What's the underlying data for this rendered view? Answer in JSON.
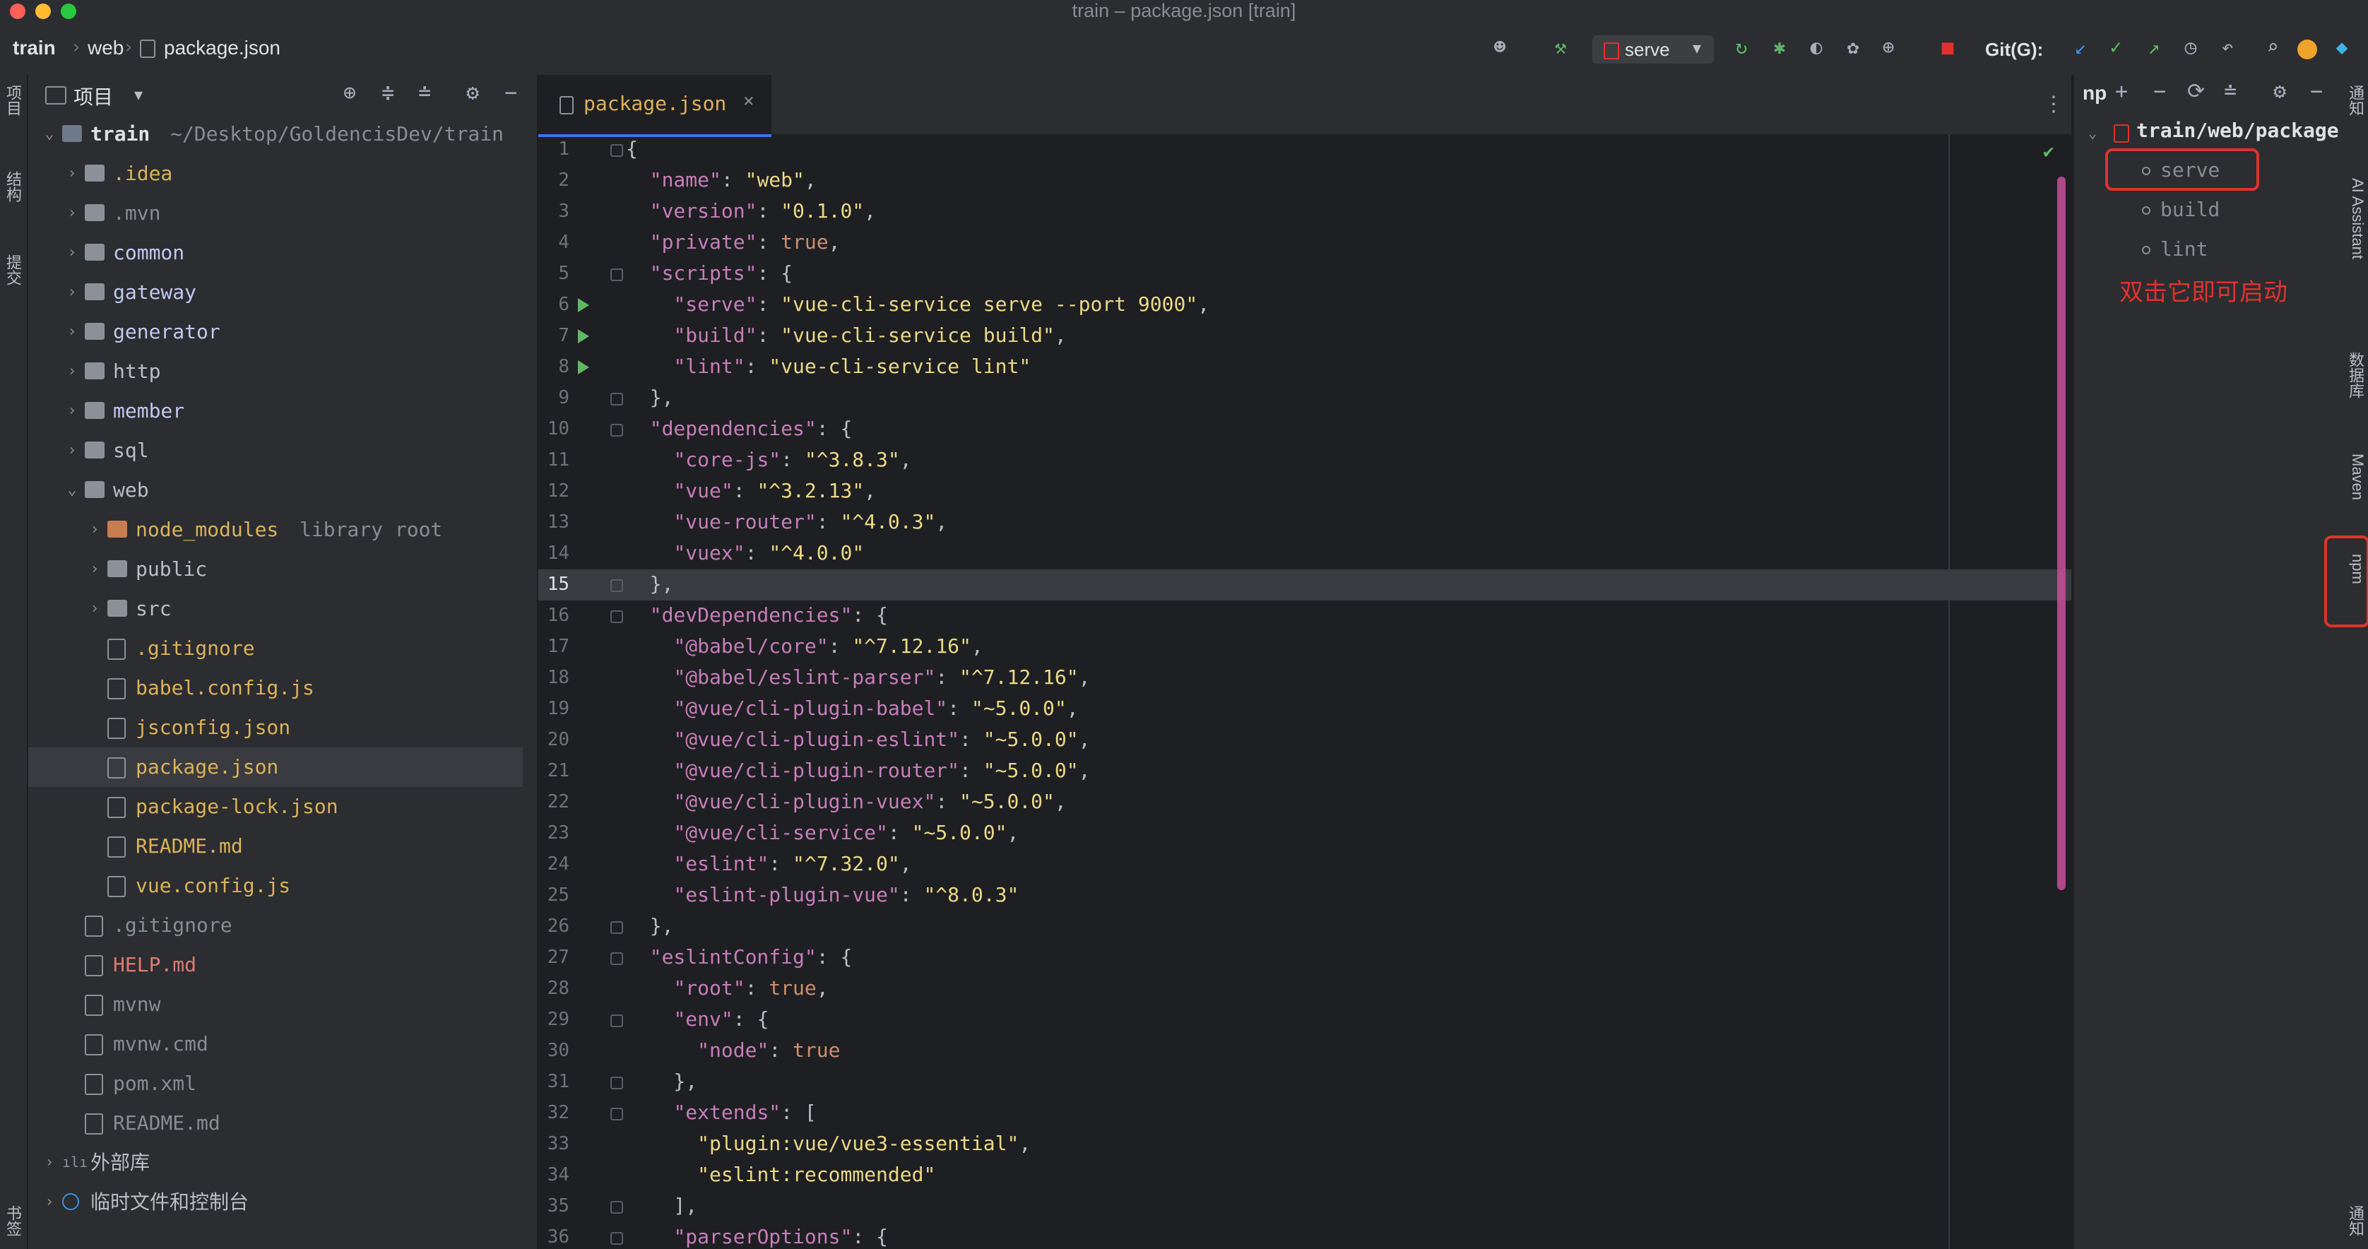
{
  "window": {
    "title": "train – package.json [train]",
    "traffic_lights": [
      "#fe5f57",
      "#febc2e",
      "#28c840"
    ]
  },
  "breadcrumb": [
    "train",
    "web",
    "package.json"
  ],
  "toolbar": {
    "run_config": "serve",
    "git_label": "Git(G):"
  },
  "left_strip": [
    "项目",
    "结构",
    "提交",
    "书签"
  ],
  "project": {
    "title": "项目",
    "items": [
      {
        "label": "train",
        "hint": "~/Desktop/GoldencisDev/train",
        "kind": "root",
        "depth": 0,
        "open": true,
        "color": "#dfe1e5"
      },
      {
        "label": ".idea",
        "kind": "folder",
        "depth": 1,
        "color": "#dcb25a"
      },
      {
        "label": ".mvn",
        "kind": "folder",
        "depth": 1,
        "color": "#8a8c92"
      },
      {
        "label": "common",
        "kind": "folder",
        "depth": 1,
        "color": "#c1c8f0"
      },
      {
        "label": "gateway",
        "kind": "folder",
        "depth": 1,
        "color": "#c1c8f0"
      },
      {
        "label": "generator",
        "kind": "folder",
        "depth": 1,
        "color": "#c1c8f0"
      },
      {
        "label": "http",
        "kind": "folder",
        "depth": 1,
        "color": "#bcbec4"
      },
      {
        "label": "member",
        "kind": "folder",
        "depth": 1,
        "color": "#c1c8f0"
      },
      {
        "label": "sql",
        "kind": "folder",
        "depth": 1,
        "color": "#bcbec4"
      },
      {
        "label": "web",
        "kind": "folder",
        "depth": 1,
        "open": true,
        "color": "#bcbec4"
      },
      {
        "label": "node_modules",
        "hint": "library root",
        "kind": "folder-orange",
        "depth": 2,
        "color": "#dcb25a"
      },
      {
        "label": "public",
        "kind": "folder",
        "depth": 2,
        "color": "#bcbec4"
      },
      {
        "label": "src",
        "kind": "folder",
        "depth": 2,
        "color": "#bcbec4"
      },
      {
        "label": ".gitignore",
        "kind": "file",
        "depth": 2,
        "leaf": true,
        "color": "#dcb25a"
      },
      {
        "label": "babel.config.js",
        "kind": "file",
        "depth": 2,
        "leaf": true,
        "color": "#dcb25a"
      },
      {
        "label": "jsconfig.json",
        "kind": "file",
        "depth": 2,
        "leaf": true,
        "color": "#dcb25a"
      },
      {
        "label": "package.json",
        "kind": "file",
        "depth": 2,
        "leaf": true,
        "selected": true,
        "color": "#dcb25a"
      },
      {
        "label": "package-lock.json",
        "kind": "file",
        "depth": 2,
        "leaf": true,
        "color": "#dcb25a"
      },
      {
        "label": "README.md",
        "kind": "file",
        "depth": 2,
        "leaf": true,
        "color": "#dcb25a"
      },
      {
        "label": "vue.config.js",
        "kind": "file",
        "depth": 2,
        "leaf": true,
        "color": "#dcb25a"
      },
      {
        "label": ".gitignore",
        "kind": "file",
        "depth": 1,
        "leaf": true,
        "color": "#8a8c92"
      },
      {
        "label": "HELP.md",
        "kind": "file",
        "depth": 1,
        "leaf": true,
        "color": "#e07a72"
      },
      {
        "label": "mvnw",
        "kind": "file",
        "depth": 1,
        "leaf": true,
        "color": "#8a8c92"
      },
      {
        "label": "mvnw.cmd",
        "kind": "file",
        "depth": 1,
        "leaf": true,
        "color": "#8a8c92"
      },
      {
        "label": "pom.xml",
        "kind": "file",
        "depth": 1,
        "leaf": true,
        "color": "#8a8c92"
      },
      {
        "label": "README.md",
        "kind": "file",
        "depth": 1,
        "leaf": true,
        "color": "#8a8c92"
      },
      {
        "label": "外部库",
        "kind": "lib",
        "depth": 0,
        "color": "#bcbec4"
      },
      {
        "label": "临时文件和控制台",
        "kind": "scratch",
        "depth": 0,
        "color": "#bcbec4"
      }
    ]
  },
  "editor": {
    "tab": "package.json",
    "current_line": 15,
    "lines": [
      "{",
      "  \"name\": \"web\",",
      "  \"version\": \"0.1.0\",",
      "  \"private\": true,",
      "  \"scripts\": {",
      "    \"serve\": \"vue-cli-service serve --port 9000\",",
      "    \"build\": \"vue-cli-service build\",",
      "    \"lint\": \"vue-cli-service lint\"",
      "  },",
      "  \"dependencies\": {",
      "    \"core-js\": \"^3.8.3\",",
      "    \"vue\": \"^3.2.13\",",
      "    \"vue-router\": \"^4.0.3\",",
      "    \"vuex\": \"^4.0.0\"",
      "  },",
      "  \"devDependencies\": {",
      "    \"@babel/core\": \"^7.12.16\",",
      "    \"@babel/eslint-parser\": \"^7.12.16\",",
      "    \"@vue/cli-plugin-babel\": \"~5.0.0\",",
      "    \"@vue/cli-plugin-eslint\": \"~5.0.0\",",
      "    \"@vue/cli-plugin-router\": \"~5.0.0\",",
      "    \"@vue/cli-plugin-vuex\": \"~5.0.0\",",
      "    \"@vue/cli-service\": \"~5.0.0\",",
      "    \"eslint\": \"^7.32.0\",",
      "    \"eslint-plugin-vue\": \"^8.0.3\"",
      "  },",
      "  \"eslintConfig\": {",
      "    \"root\": true,",
      "    \"env\": {",
      "      \"node\": true",
      "    },",
      "    \"extends\": [",
      "      \"plugin:vue/vue3-essential\",",
      "      \"eslint:recommended\"",
      "    ],",
      "    \"parserOptions\": {"
    ],
    "run_lines": [
      6,
      7,
      8
    ],
    "fold_lines": [
      1,
      5,
      9,
      10,
      15,
      16,
      26,
      27,
      29,
      31,
      32,
      35,
      36
    ]
  },
  "npm": {
    "title": "np",
    "root": "train/web/package",
    "scripts": [
      "serve",
      "build",
      "lint"
    ],
    "annotation": "双击它即可启动"
  },
  "right_strip": [
    "通知",
    "AI Assistant",
    "数据库",
    "Maven",
    "npm",
    "通知"
  ]
}
